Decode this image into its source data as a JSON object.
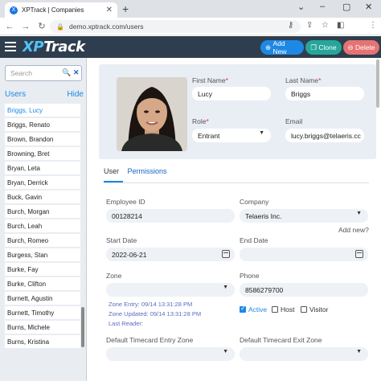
{
  "browser": {
    "tab_title": "XPTrack | Companies",
    "favicon_letter": "X",
    "url": "demo.xptrack.com/users",
    "profile_initial": "R"
  },
  "app": {
    "logo_prefix": "XP",
    "logo_suffix": "Track",
    "buttons": {
      "add_new": "Add New",
      "clone": "Clone",
      "delete": "Delete"
    },
    "colors": {
      "header": "#2f3e4e",
      "add_new": "#1e88e5",
      "clone": "#26a69a",
      "delete": "#e57373"
    }
  },
  "sidebar": {
    "search_placeholder": "Search",
    "title": "Users",
    "hide_label": "Hide",
    "users": [
      "Briggs, Lucy",
      "Briggs, Renato",
      "Brown, Brandon",
      "Browning, Bret",
      "Bryan, Leta",
      "Bryan, Derrick",
      "Buck, Gavin",
      "Burch, Morgan",
      "Burch, Leah",
      "Burch, Romeo",
      "Burgess, Stan",
      "Burke, Fay",
      "Burke, Clifton",
      "Burnett, Agustin",
      "Burnett, Timothy",
      "Burns, Michele",
      "Burns, Kristina"
    ],
    "active_index": 0
  },
  "profile": {
    "first_name_label": "First Name",
    "first_name": "Lucy",
    "last_name_label": "Last Name",
    "last_name": "Briggs",
    "role_label": "Role",
    "role": "Entrant",
    "email_label": "Email",
    "email": "lucy.briggs@telaeris.cc"
  },
  "tabs": {
    "user": "User",
    "permissions": "Permissions"
  },
  "form": {
    "employee_id_label": "Employee ID",
    "employee_id": "00128214",
    "company_label": "Company",
    "company": "Telaeris Inc.",
    "add_new_link": "Add new?",
    "start_date_label": "Start Date",
    "start_date": "2022-06-21",
    "end_date_label": "End Date",
    "end_date": "",
    "zone_label": "Zone",
    "zone": "",
    "phone_label": "Phone",
    "phone": "8586279700",
    "zone_entry": "Zone Entry:  09/14 13:31:28 PM",
    "zone_updated": "Zone Updated: 09/14 13:31:28 PM",
    "last_reader": "Last Reader:",
    "active_label": "Active",
    "host_label": "Host",
    "visitor_label": "Visitor",
    "active_checked": true,
    "host_checked": false,
    "visitor_checked": false,
    "entry_zone_label": "Default Timecard Entry Zone",
    "exit_zone_label": "Default Timecard Exit Zone"
  }
}
